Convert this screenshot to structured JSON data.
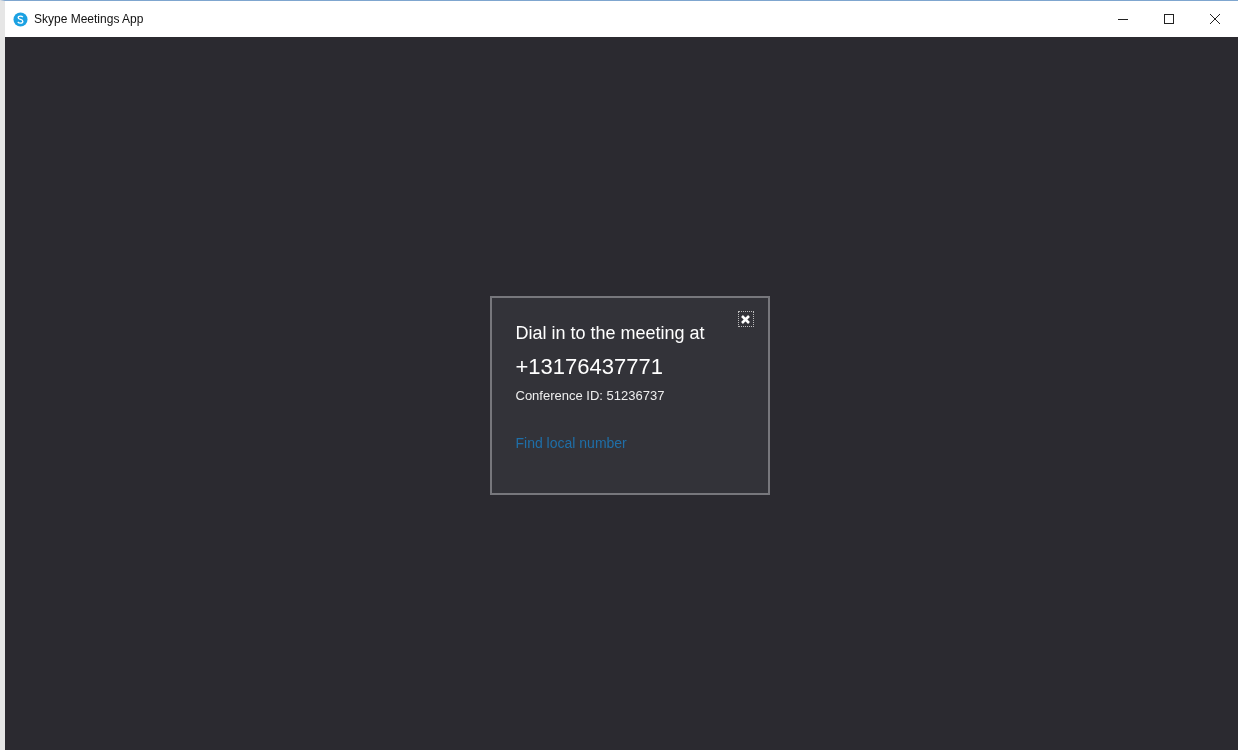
{
  "window": {
    "title": "Skype Meetings App"
  },
  "dialog": {
    "heading": "Dial in to the meeting at",
    "phone": "+13176437771",
    "conference": "Conference ID: 51236737",
    "link": "Find local number"
  }
}
